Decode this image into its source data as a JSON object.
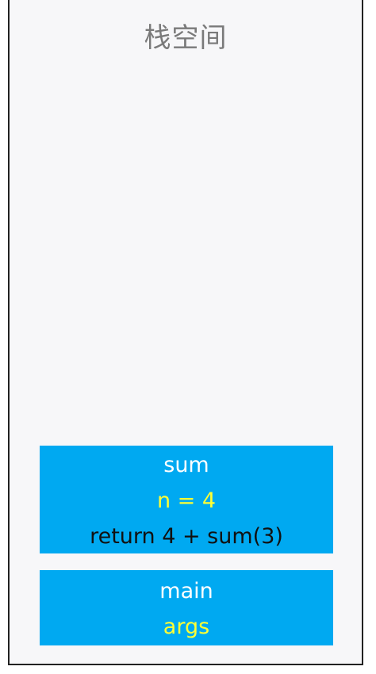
{
  "stack": {
    "title": "栈空间",
    "frames": [
      {
        "name": "sum",
        "variable": "n = 4",
        "statement": "return 4 + sum(3)"
      },
      {
        "name": "main",
        "variable": "args"
      }
    ]
  },
  "colors": {
    "frame_fill": "#00a9f1",
    "function_name_text": "#ffffff",
    "variable_text": "#ffff33",
    "statement_text": "#111111",
    "title_text": "#7a7a7a",
    "border": "#222222"
  }
}
